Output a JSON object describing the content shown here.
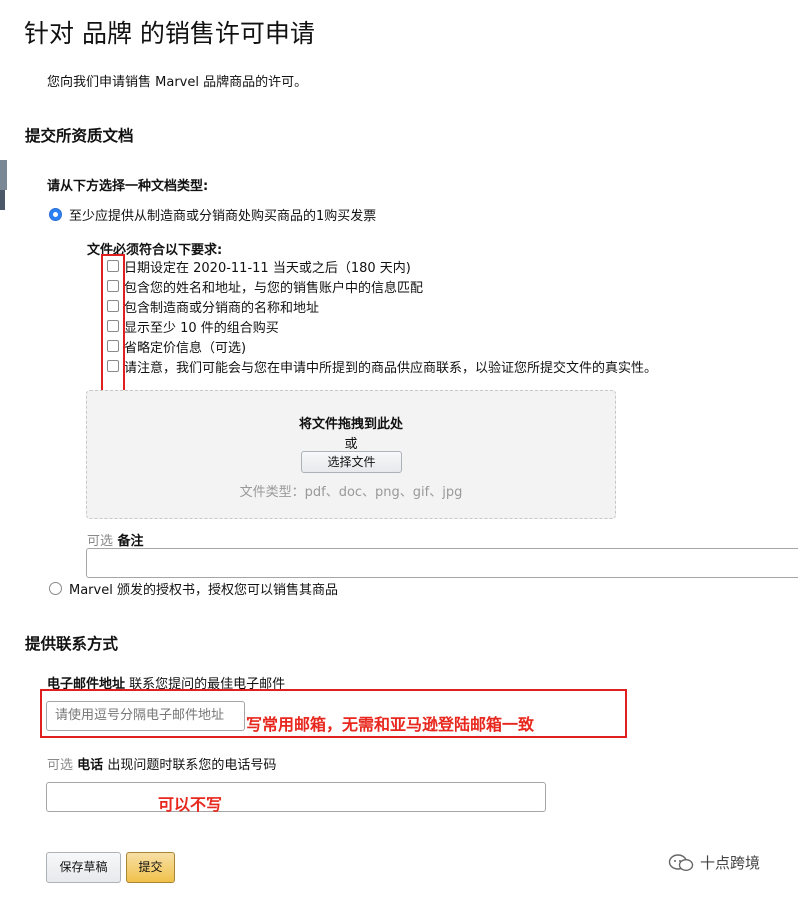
{
  "header": {
    "title": "针对 品牌 的销售许可申请"
  },
  "intro": "您向我们申请销售 Marvel 品牌商品的许可。",
  "documents_section": {
    "title": "提交所资质文档",
    "choose_label": "请从下方选择一种文档类型:",
    "option1_label": "至少应提供从制造商或分销商处购买商品的1购买发票",
    "option1_selected": true,
    "requirements_title": "文件必须符合以下要求:",
    "requirements": [
      "日期设定在 2020-11-11 当天或之后（180 天内)",
      "包含您的姓名和地址，与您的销售账户中的信息匹配",
      "包含制造商或分销商的名称和地址",
      "显示至少 10 件的组合购买",
      "省略定价信息（可选)",
      "请注意，我们可能会与您在申请中所提到的商品供应商联系，以验证您所提交文件的真实性。"
    ],
    "dropzone": {
      "title": "将文件拖拽到此处",
      "or": "或",
      "choose_button": "选择文件",
      "file_types": "文件类型：pdf、doc、png、gif、jpg"
    },
    "notes": {
      "optional_tag": "可选",
      "label": "备注"
    },
    "option2_label": "Marvel 颁发的授权书，授权您可以销售其商品",
    "option2_selected": false
  },
  "contact_section": {
    "title": "提供联系方式",
    "email_label": "电子邮件地址",
    "email_hint": "联系您提问的最佳电子邮件",
    "email_placeholder": "请使用逗号分隔电子邮件地址",
    "phone_optional_tag": "可选",
    "phone_label": "电话",
    "phone_hint": "出现问题时联系您的电话号码"
  },
  "annotations": {
    "email_note": "写常用邮箱，无需和亚马逊登陆邮箱一致",
    "phone_note": "可以不写"
  },
  "buttons": {
    "save_draft": "保存草稿",
    "submit": "提交"
  },
  "watermark": {
    "text": "十点跨境"
  },
  "colors": {
    "annotation_red": "#e02020",
    "submit_yellow": "#f0c14b",
    "radio_blue": "#2b80f5"
  }
}
